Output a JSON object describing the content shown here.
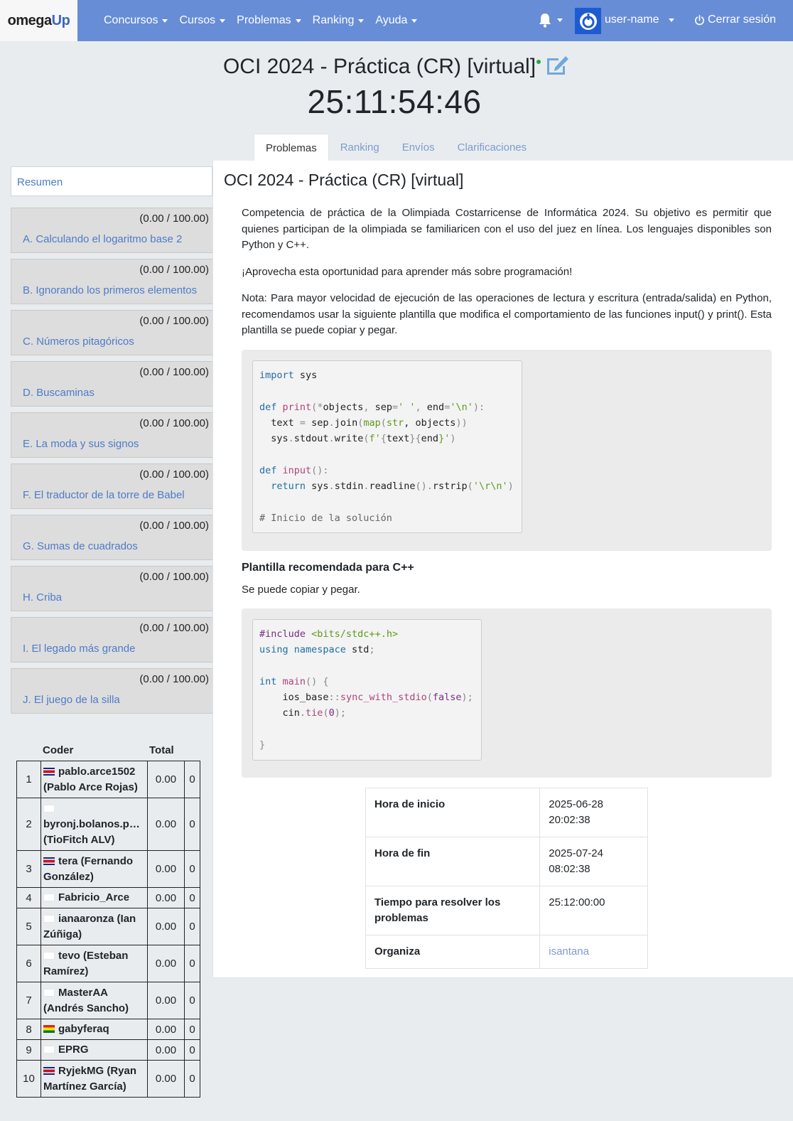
{
  "navbar": {
    "brand_part1": "omega",
    "brand_part2": "Up",
    "items": [
      "Concursos",
      "Cursos",
      "Problemas",
      "Ranking",
      "Ayuda"
    ],
    "username": "user-name",
    "logout": "Cerrar sesión"
  },
  "contest": {
    "title": "OCI 2024 - Práctica (CR) [virtual]",
    "clock": "25:11:54:46"
  },
  "tabs": [
    "Problemas",
    "Ranking",
    "Envíos",
    "Clarificaciones"
  ],
  "sidebar": {
    "summary": "Resumen",
    "problems": [
      {
        "score": "(0.00 / 100.00)",
        "name": "A. Calculando el logaritmo base 2"
      },
      {
        "score": "(0.00 / 100.00)",
        "name": "B. Ignorando los primeros elementos"
      },
      {
        "score": "(0.00 / 100.00)",
        "name": "C. Números pitagóricos"
      },
      {
        "score": "(0.00 / 100.00)",
        "name": "D. Buscaminas"
      },
      {
        "score": "(0.00 / 100.00)",
        "name": "E. La moda y sus signos"
      },
      {
        "score": "(0.00 / 100.00)",
        "name": "F. El traductor de la torre de Babel"
      },
      {
        "score": "(0.00 / 100.00)",
        "name": "G. Sumas de cuadrados"
      },
      {
        "score": "(0.00 / 100.00)",
        "name": "H. Criba"
      },
      {
        "score": "(0.00 / 100.00)",
        "name": "I. El legado más grande"
      },
      {
        "score": "(0.00 / 100.00)",
        "name": "J. El juego de la silla"
      }
    ]
  },
  "scoreboard": {
    "col_coder": "Coder",
    "col_total": "Total",
    "rows": [
      {
        "rank": "1",
        "flag": "cr",
        "line1": "pablo.arce1502",
        "line2": "(Pablo Arce Rojas)",
        "points": "0.00",
        "penalty": "0"
      },
      {
        "rank": "2",
        "flag": "none",
        "line1": "byronj.bolanos.p…",
        "line2": "(TioFitch ALV)",
        "points": "0.00",
        "penalty": "0"
      },
      {
        "rank": "3",
        "flag": "cr",
        "line1": "tera (Fernando",
        "line2": "González)",
        "points": "0.00",
        "penalty": "0"
      },
      {
        "rank": "4",
        "flag": "none",
        "line1": "Fabricio_Arce",
        "line2": "",
        "points": "0.00",
        "penalty": "0"
      },
      {
        "rank": "5",
        "flag": "none",
        "line1": "ianaaronza (Ian",
        "line2": "Zúñiga)",
        "points": "0.00",
        "penalty": "0"
      },
      {
        "rank": "6",
        "flag": "none",
        "line1": "tevo (Esteban",
        "line2": "Ramírez)",
        "points": "0.00",
        "penalty": "0"
      },
      {
        "rank": "7",
        "flag": "none",
        "line1": "MasterAA",
        "line2": "(Andrés Sancho)",
        "points": "0.00",
        "penalty": "0"
      },
      {
        "rank": "8",
        "flag": "bo",
        "line1": "gabyferaq",
        "line2": "",
        "points": "0.00",
        "penalty": "0"
      },
      {
        "rank": "9",
        "flag": "none",
        "line1": "EPRG",
        "line2": "",
        "points": "0.00",
        "penalty": "0"
      },
      {
        "rank": "10",
        "flag": "cr",
        "line1": "RyjekMG (Ryan",
        "line2": "Martínez García)",
        "points": "0.00",
        "penalty": "0"
      }
    ]
  },
  "main": {
    "title": "OCI 2024 - Práctica (CR) [virtual]",
    "para1": "Competencia de práctica de la Olimpiada Costarricense de Informática 2024. Su objetivo es permitir que quienes participan de la olimpiada se familiaricen con el uso del juez en línea. Los lenguajes disponibles son Python y C++.",
    "para2": "¡Aprovecha esta oportunidad para aprender más sobre programación!",
    "para3": "Nota: Para mayor velocidad de ejecución de las operaciones de lectura y escritura (entrada/salida) en Python, recomendamos usar la siguiente plantilla que modifica el comportamiento de las funciones input() y print(). Esta plantilla se puede copiar y pegar.",
    "cpp_heading": "Plantilla recomendada para C++",
    "cpp_sub": "Se puede copiar y pegar.",
    "python_code": {
      "l1_kw": "import",
      "l1_rest": " sys",
      "l3_def": "def",
      "l3_fn": "print",
      "l3_a": "(*",
      "l3_b": "objects",
      "l3_c": ", ",
      "l3_d": "sep",
      "l3_e": "=",
      "l3_f": "' '",
      "l3_g": ", ",
      "l3_h": "end",
      "l3_i": "=",
      "l3_j": "'\\n'",
      "l3_k": "):",
      "l4_a": "  text ",
      "l4_b": "=",
      "l4_c": " sep",
      "l4_d": ".",
      "l4_e": "join",
      "l4_f": "(",
      "l4_g": "map",
      "l4_h": "(",
      "l4_i": "str",
      "l4_j": ", objects",
      "l4_k": "))",
      "l5_a": "  sys",
      "l5_b": ".",
      "l5_c": "stdout",
      "l5_d": ".",
      "l5_e": "write",
      "l5_f": "(",
      "l5_g": "f'",
      "l5_h": "{",
      "l5_i": "text",
      "l5_j": "}{",
      "l5_k": "end",
      "l5_l": "}'",
      "l5_m": ")",
      "l7_def": "def",
      "l7_fn": "input",
      "l7_rest": "():",
      "l8_kw": "  return",
      "l8_a": " sys",
      "l8_b": ".",
      "l8_c": "stdin",
      "l8_d": ".",
      "l8_e": "readline",
      "l8_f": "().",
      "l8_g": "rstrip",
      "l8_h": "(",
      "l8_i": "'\\r\\n'",
      "l8_j": ")",
      "l10_cm": "# Inicio de la solución"
    },
    "cpp_code": {
      "l1_pp": "#include",
      "l1_st": " <bits/stdc++.h>",
      "l2_kw": "using namespace",
      "l2_rest": " std",
      "l2_semi": ";",
      "l4_kw": "int",
      "l4_fn": " main",
      "l4_rest": "() {",
      "l5_a": "    ios_base",
      "l5_b": "::",
      "l5_c": "sync_with_stdio",
      "l5_d": "(",
      "l5_e": "false",
      "l5_f": ");",
      "l6_a": "    cin",
      "l6_b": ".",
      "l6_c": "tie",
      "l6_d": "(",
      "l6_e": "0",
      "l6_f": ");",
      "l8": "}"
    },
    "info": [
      {
        "label": "Hora de inicio",
        "value": "2025-06-28 20:02:38"
      },
      {
        "label": "Hora de fin",
        "value": "2025-07-24 08:02:38"
      },
      {
        "label": "Tiempo para resolver los problemas",
        "value": "25:12:00:00"
      },
      {
        "label": "Organiza",
        "value": "isantana"
      }
    ]
  }
}
